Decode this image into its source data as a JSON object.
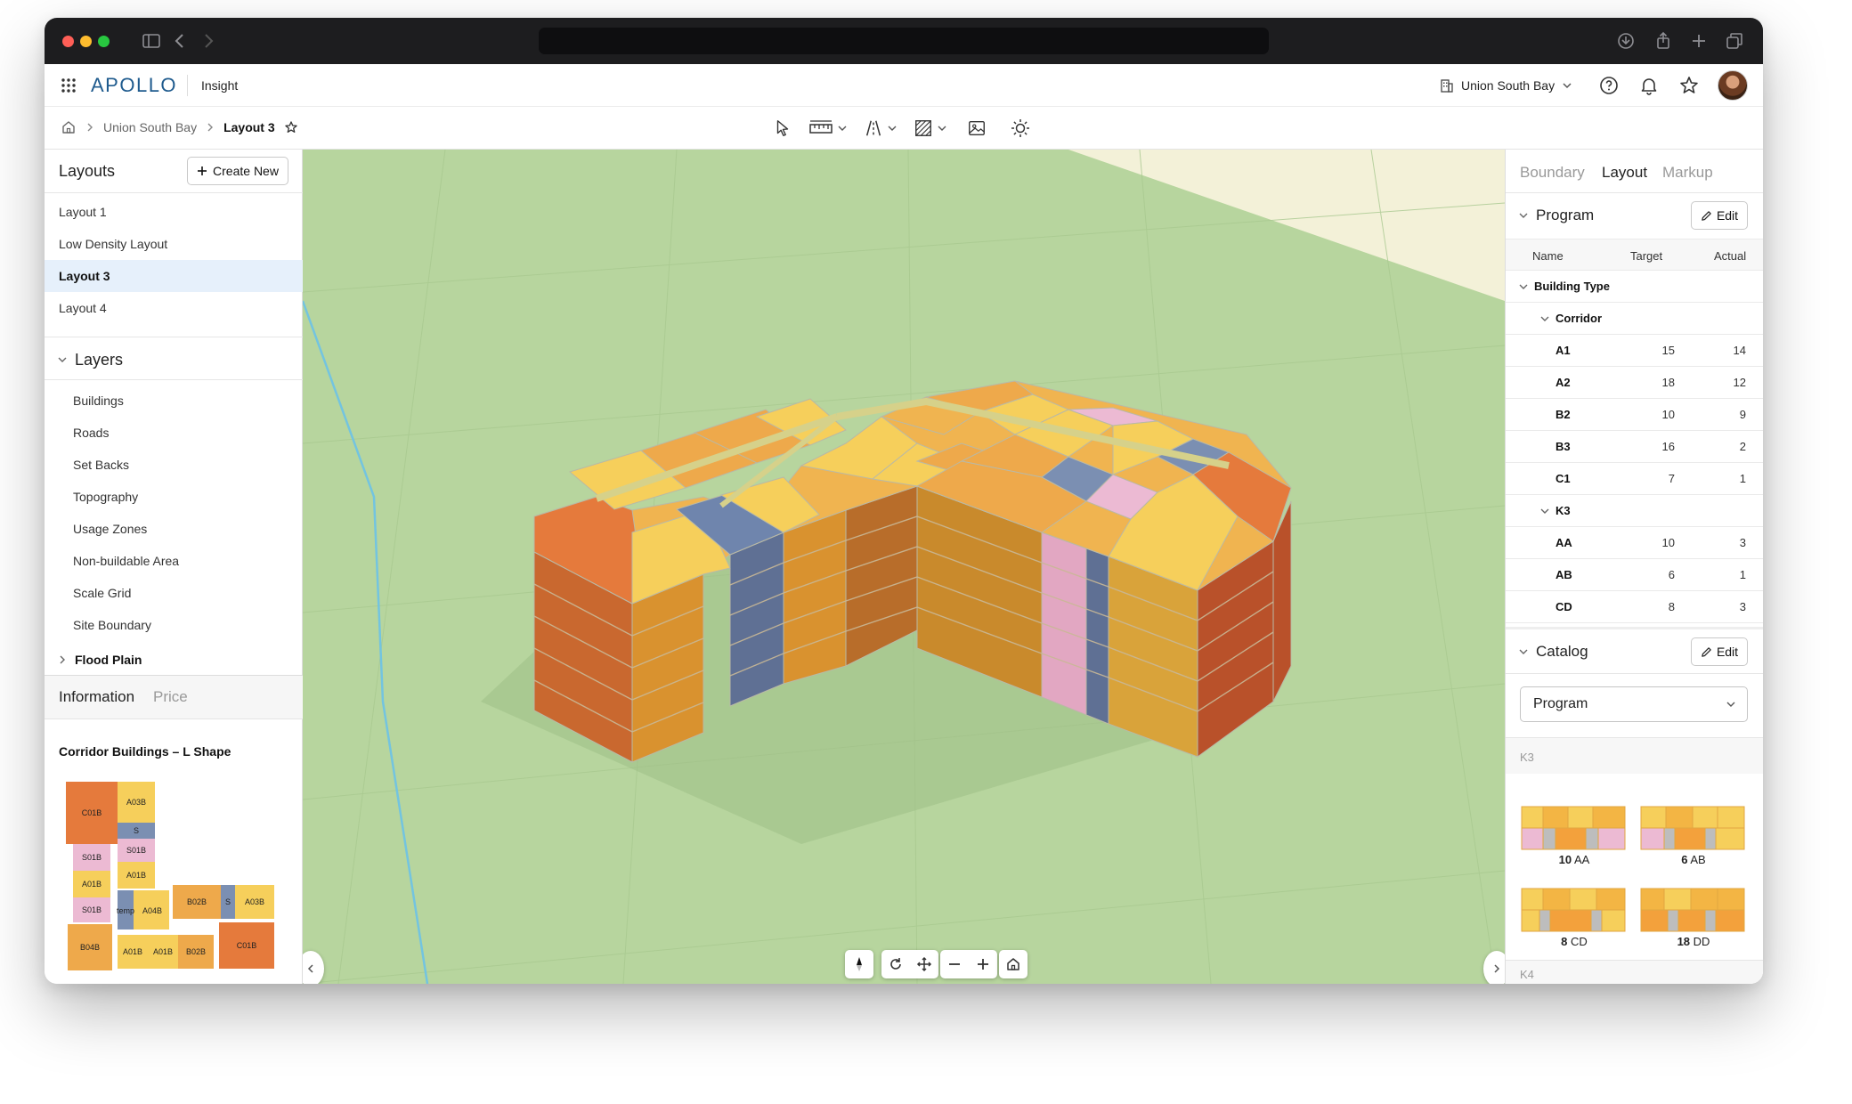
{
  "app": {
    "brand": "APOLLO",
    "name": "Insight",
    "project": "Union South Bay"
  },
  "breadcrumb": {
    "parent": "Union South Bay",
    "current": "Layout 3"
  },
  "layouts_panel": {
    "title": "Layouts",
    "create_label": "Create New",
    "items": [
      "Layout 1",
      "Low Density Layout",
      "Layout 3",
      "Layout 4"
    ],
    "active": "Layout 3"
  },
  "layers_panel": {
    "title": "Layers",
    "items": [
      "Buildings",
      "Roads",
      "Set Backs",
      "Topography",
      "Usage Zones",
      "Non-buildable Area",
      "Scale Grid",
      "Site Boundary"
    ],
    "collapsed_item": "Flood Plain"
  },
  "info_panel": {
    "tabs": [
      "Information",
      "Price"
    ],
    "title": "Corridor Buildings – L Shape",
    "plan_labels": [
      "C01B",
      "A03B",
      "S",
      "S01B",
      "S01B",
      "A01B",
      "A01B",
      "S01B",
      "temp",
      "A04B",
      "B02B",
      "S",
      "A03B",
      "B04B",
      "A01B",
      "A01B",
      "B02B",
      "C01B"
    ]
  },
  "right_panel": {
    "tabs": [
      "Boundary",
      "Layout",
      "Markup"
    ],
    "active_tab": "Layout",
    "program": {
      "title": "Program",
      "edit_label": "Edit",
      "columns": [
        "Name",
        "Target",
        "Actual"
      ],
      "group": "Building Type",
      "subgroups": [
        {
          "name": "Corridor",
          "rows": [
            {
              "name": "A1",
              "target": "15",
              "actual": "14"
            },
            {
              "name": "A2",
              "target": "18",
              "actual": "12"
            },
            {
              "name": "B2",
              "target": "10",
              "actual": "9"
            },
            {
              "name": "B3",
              "target": "16",
              "actual": "2"
            },
            {
              "name": "C1",
              "target": "7",
              "actual": "1"
            }
          ]
        },
        {
          "name": "K3",
          "rows": [
            {
              "name": "AA",
              "target": "10",
              "actual": "3"
            },
            {
              "name": "AB",
              "target": "6",
              "actual": "1"
            },
            {
              "name": "CD",
              "target": "8",
              "actual": "3"
            }
          ]
        }
      ]
    },
    "catalog": {
      "title": "Catalog",
      "edit_label": "Edit",
      "select_value": "Program",
      "groups": [
        "K3",
        "K4"
      ],
      "cards": [
        {
          "count": "10",
          "code": "AA"
        },
        {
          "count": "6",
          "code": "AB"
        },
        {
          "count": "8",
          "code": "CD"
        },
        {
          "count": "18",
          "code": "DD"
        }
      ]
    }
  },
  "colors": {
    "orange_dark": "#e57a3c",
    "orange": "#eea94b",
    "yellow": "#f6cf5b",
    "pink": "#ecbad3",
    "blue_gray": "#7b8fb2",
    "ground": "#b7d59e",
    "accent": "#1f5b8e"
  }
}
